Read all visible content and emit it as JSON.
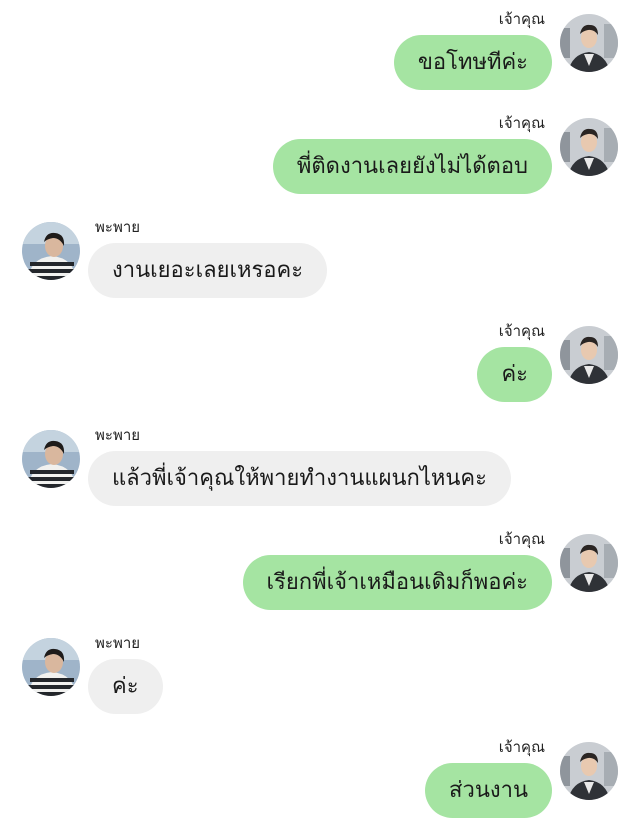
{
  "senders": {
    "me": "เจ้าคุณ",
    "other": "พะพาย"
  },
  "messages": [
    {
      "side": "right",
      "text": "ขอโทษทีค่ะ"
    },
    {
      "side": "right",
      "text": "พี่ติดงานเลยยังไม่ได้ตอบ"
    },
    {
      "side": "left",
      "text": "งานเยอะเลยเหรอคะ"
    },
    {
      "side": "right",
      "text": "ค่ะ"
    },
    {
      "side": "left",
      "text": "แล้วพี่เจ้าคุณให้พายทำงานแผนกไหนคะ"
    },
    {
      "side": "right",
      "text": "เรียกพี่เจ้าเหมือนเดิมก็พอค่ะ"
    },
    {
      "side": "left",
      "text": "ค่ะ"
    },
    {
      "side": "right",
      "text": "ส่วนงาน"
    }
  ],
  "colors": {
    "outgoing_bubble": "#a5e4a2",
    "incoming_bubble": "#efefef"
  },
  "icons": {
    "me_avatar": "avatar-man-suit-icon",
    "other_avatar": "avatar-person-striped-sweater-icon"
  }
}
